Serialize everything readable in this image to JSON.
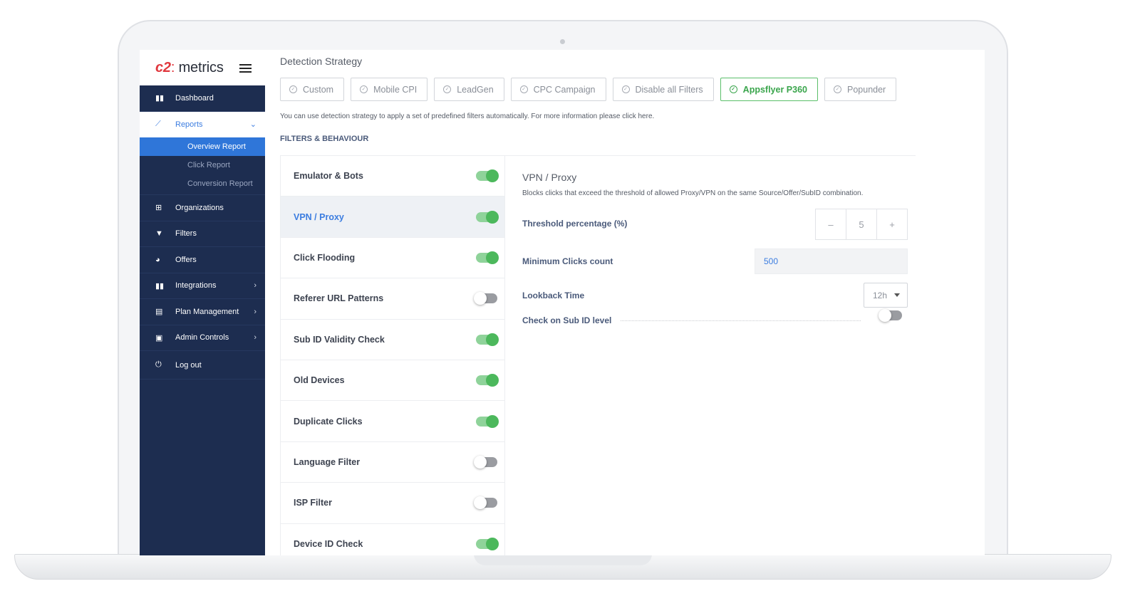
{
  "app": {
    "logo_mark": "c2",
    "logo_text": "metrics"
  },
  "sidebar": {
    "items": [
      {
        "label": "Dashboard",
        "icon": "bar-chart-icon"
      },
      {
        "label": "Reports",
        "icon": "trend-line-icon"
      },
      {
        "label": "Organizations",
        "icon": "org-chart-icon"
      },
      {
        "label": "Filters",
        "icon": "funnel-icon"
      },
      {
        "label": "Offers",
        "icon": "pie-chart-icon"
      },
      {
        "label": "Integrations",
        "icon": "bar-chart-icon"
      },
      {
        "label": "Plan Management",
        "icon": "document-icon"
      },
      {
        "label": "Admin Controls",
        "icon": "toolbox-icon"
      },
      {
        "label": "Log out",
        "icon": "power-icon"
      }
    ],
    "reports_sub": [
      "Overview Report",
      "Click Report",
      "Conversion Report"
    ],
    "selected_sub": "Overview Report"
  },
  "main": {
    "title": "Detection Strategy",
    "strategies": [
      "Custom",
      "Mobile CPI",
      "LeadGen",
      "CPC Campaign",
      "Disable all Filters",
      "Appsflyer P360",
      "Popunder"
    ],
    "active_strategy": "Appsflyer P360",
    "info": "You can use detection strategy to apply a set of predefined filters automatically. For more information please click here.",
    "section_title": "FILTERS & BEHAVIOUR"
  },
  "filters": [
    {
      "name": "Emulator & Bots",
      "enabled": true
    },
    {
      "name": "VPN / Proxy",
      "enabled": true
    },
    {
      "name": "Click Flooding",
      "enabled": true
    },
    {
      "name": "Referer URL Patterns",
      "enabled": false
    },
    {
      "name": "Sub ID Validity Check",
      "enabled": true
    },
    {
      "name": "Old Devices",
      "enabled": true
    },
    {
      "name": "Duplicate Clicks",
      "enabled": true
    },
    {
      "name": "Language Filter",
      "enabled": false
    },
    {
      "name": "ISP Filter",
      "enabled": false
    },
    {
      "name": "Device ID Check",
      "enabled": true
    }
  ],
  "detail": {
    "title": "VPN / Proxy",
    "description": "Blocks clicks that exceed the threshold of allowed Proxy/VPN on the same Source/Offer/SubID combination.",
    "threshold_label": "Threshold percentage (%)",
    "threshold_value": "5",
    "minus": "–",
    "plus": "+",
    "min_clicks_label": "Minimum Clicks count",
    "min_clicks_value": "500",
    "lookback_label": "Lookback Time",
    "lookback_value": "12h",
    "subid_label": "Check on Sub ID level",
    "subid_enabled": false
  },
  "colors": {
    "sidebar": "#1d2d50",
    "accent_blue": "#2f76d9",
    "toggle_on": "#4cb85c",
    "strategy_active": "#3aa54c"
  }
}
